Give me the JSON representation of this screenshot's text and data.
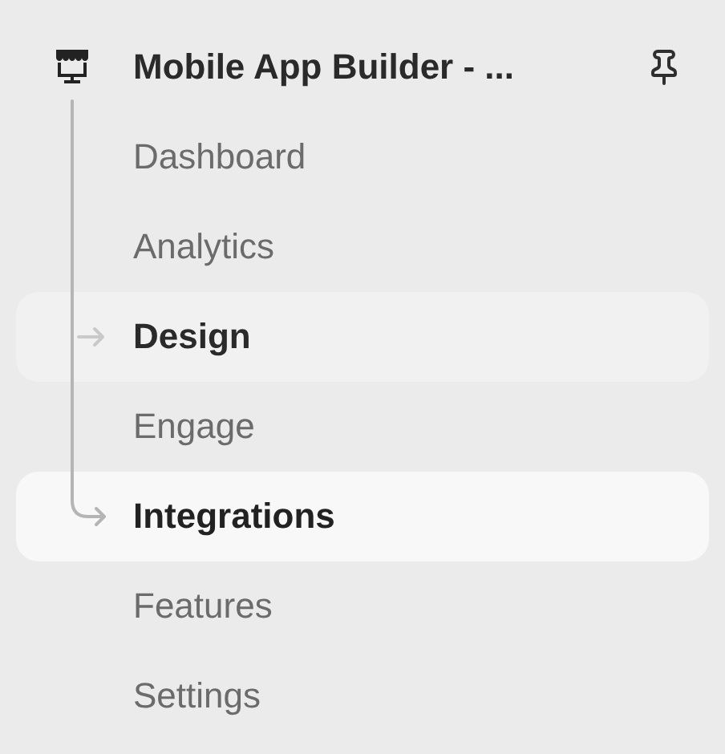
{
  "header": {
    "title": "Mobile App Builder - ..."
  },
  "items": [
    {
      "label": "Dashboard",
      "selected": false,
      "hovered": false
    },
    {
      "label": "Analytics",
      "selected": false,
      "hovered": false
    },
    {
      "label": "Design",
      "selected": false,
      "hovered": true
    },
    {
      "label": "Engage",
      "selected": false,
      "hovered": false
    },
    {
      "label": "Integrations",
      "selected": true,
      "hovered": false
    },
    {
      "label": "Features",
      "selected": false,
      "hovered": false
    },
    {
      "label": "Settings",
      "selected": false,
      "hovered": false
    }
  ]
}
